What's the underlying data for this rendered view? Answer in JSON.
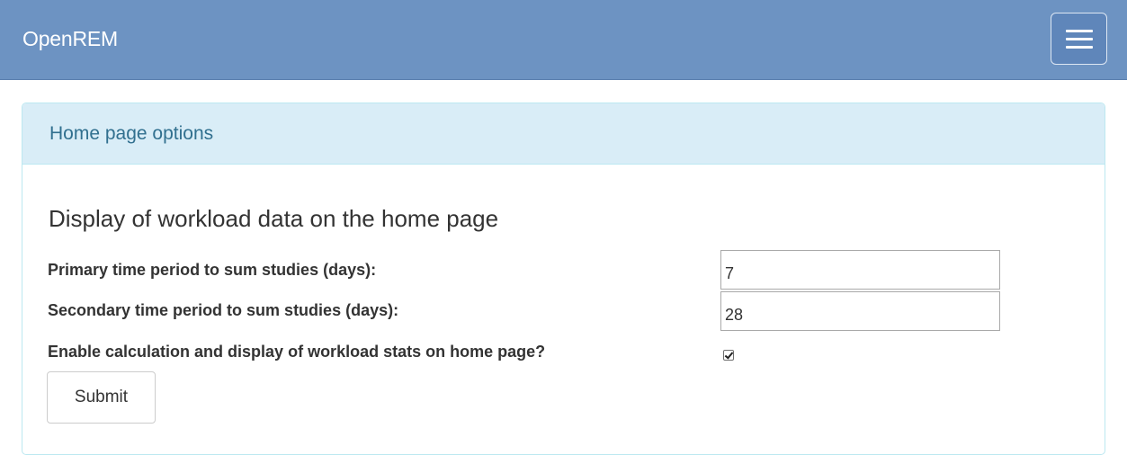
{
  "navbar": {
    "brand": "OpenREM",
    "menu_icon": "hamburger-menu-icon",
    "background_color": "#6d93c2"
  },
  "panel": {
    "heading": "Home page options",
    "heading_background": "#d9edf7",
    "heading_text_color": "#31708f",
    "section_title": "Display of workload data on the home page",
    "fields": {
      "primary": {
        "label": "Primary time period to sum studies (days):",
        "value": "7"
      },
      "secondary": {
        "label": "Secondary time period to sum studies (days):",
        "value": "28"
      },
      "enable_stats": {
        "label": "Enable calculation and display of workload stats on home page?",
        "checked": true
      }
    },
    "submit_label": "Submit"
  }
}
